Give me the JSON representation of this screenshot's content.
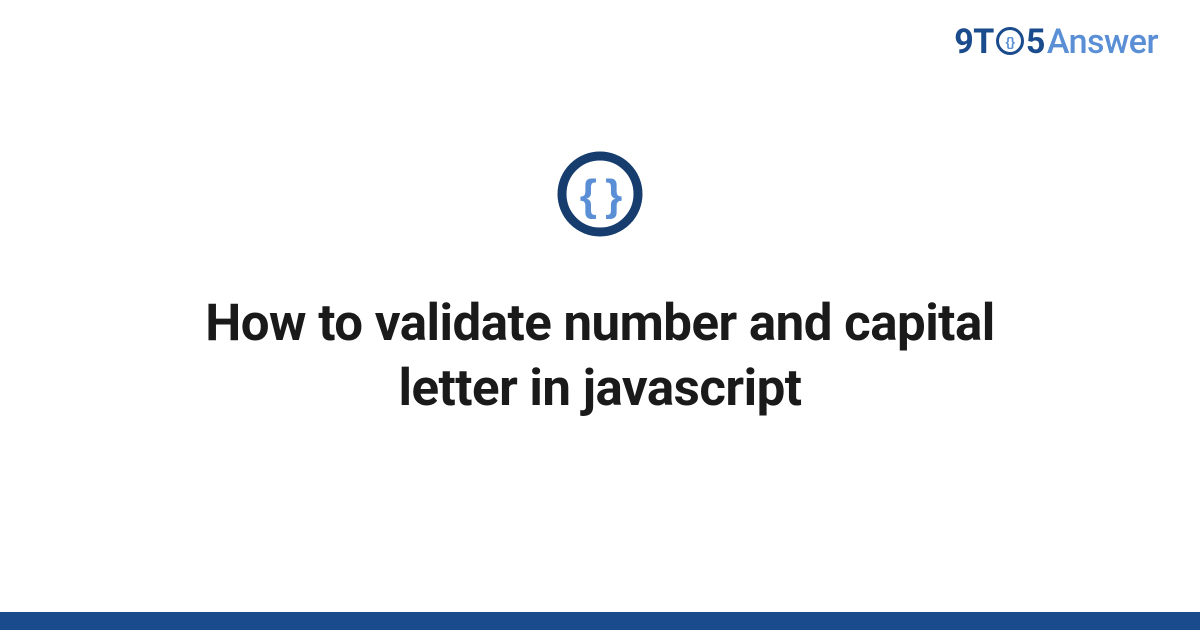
{
  "header": {
    "logo": {
      "part1": "9T",
      "part2": "5",
      "part3": "Answer"
    }
  },
  "main": {
    "title": "How to validate number and capital letter in javascript"
  },
  "colors": {
    "brand_dark": "#1a4b8c",
    "brand_light": "#5a8fd6",
    "icon_inner": "#5a8fd6",
    "icon_ring": "#163d6e"
  }
}
